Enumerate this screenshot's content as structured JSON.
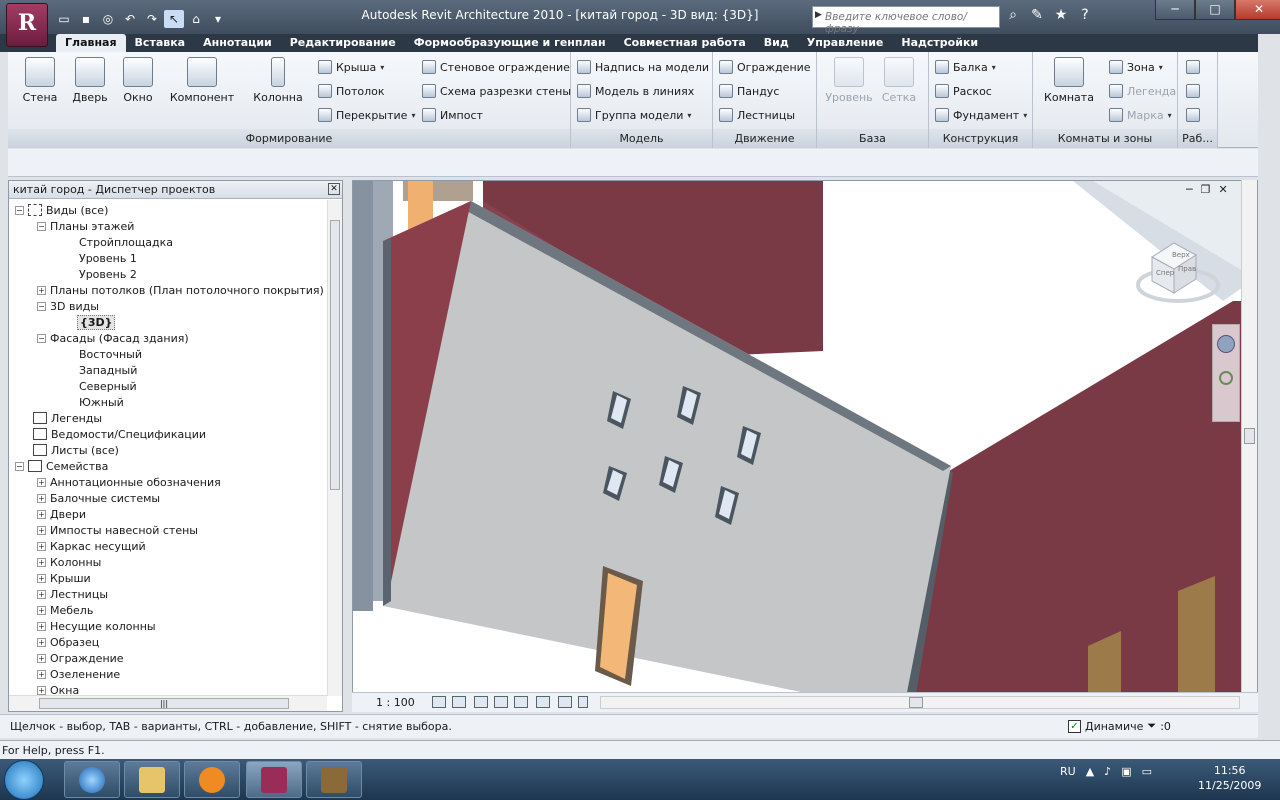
{
  "app": {
    "logo_letter": "R",
    "title": "Autodesk Revit Architecture 2010 - [китай город - 3D вид: {3D}]",
    "search_placeholder": "Введите ключевое слово/фразу",
    "controls": {
      "minimize": "─",
      "maximize": "□",
      "close": "✕"
    }
  },
  "tabs": [
    "Главная",
    "Вставка",
    "Аннотации",
    "Редактирование",
    "Формообразующие и генплан",
    "Совместная работа",
    "Вид",
    "Управление",
    "Надстройки"
  ],
  "ribbon": {
    "forming": {
      "title": "Формирование",
      "big": [
        "Стена",
        "Дверь",
        "Окно",
        "Компонент",
        "Колонна"
      ],
      "small": [
        "Крыша",
        "Потолок",
        "Перекрытие",
        "Стеновое ограждение",
        "Схема разрезки стены",
        "Импост"
      ]
    },
    "model": {
      "title": "Модель",
      "small": [
        "Надпись на модели",
        "Модель в линиях",
        "Группа модели"
      ]
    },
    "movement": {
      "title": "Движение",
      "small": [
        "Ограждение",
        "Пандус",
        "Лестницы"
      ]
    },
    "base": {
      "title": "База",
      "big": [
        "Уровень",
        "Сетка"
      ]
    },
    "construction": {
      "title": "Конструкция",
      "small": [
        "Балка",
        "Раскос",
        "Фундамент"
      ]
    },
    "rooms": {
      "title": "Комнаты и зоны",
      "big": [
        "Комната"
      ],
      "small": [
        "Зона",
        "Легенда",
        "Марка"
      ]
    },
    "work": {
      "title": "Раб..."
    }
  },
  "browser": {
    "title": "китай город - Диспетчер проектов",
    "items": [
      {
        "label": "Виды (все)"
      },
      {
        "label": "Планы этажей"
      },
      {
        "label": "Стройплощадка"
      },
      {
        "label": "Уровень 1"
      },
      {
        "label": "Уровень 2"
      },
      {
        "label": "Планы потолков (План потолочного покрытия)"
      },
      {
        "label": "3D виды"
      },
      {
        "label": "{3D}"
      },
      {
        "label": "Фасады (Фасад здания)"
      },
      {
        "label": "Восточный"
      },
      {
        "label": "Западный"
      },
      {
        "label": "Северный"
      },
      {
        "label": "Южный"
      },
      {
        "label": "Легенды"
      },
      {
        "label": "Ведомости/Спецификации"
      },
      {
        "label": "Листы (все)"
      },
      {
        "label": "Семейства"
      },
      {
        "label": "Аннотационные обозначения"
      },
      {
        "label": "Балочные системы"
      },
      {
        "label": "Двери"
      },
      {
        "label": "Импосты навесной стены"
      },
      {
        "label": "Каркас несущий"
      },
      {
        "label": "Колонны"
      },
      {
        "label": "Крыши"
      },
      {
        "label": "Лестницы"
      },
      {
        "label": "Мебель"
      },
      {
        "label": "Несущие колонны"
      },
      {
        "label": "Образец"
      },
      {
        "label": "Ограждение"
      },
      {
        "label": "Озеленение"
      },
      {
        "label": "Окна"
      }
    ]
  },
  "viewport": {
    "scale": "1 : 100",
    "viewcube": {
      "top": "Верх",
      "front": "Спер",
      "right": "Прав"
    }
  },
  "status": {
    "hint": "Щелчок - выбор, TAB - варианты, CTRL - добавление, SHIFT - снятие выбора.",
    "dynamic_label": "Динамиче",
    "filter_count": ":0",
    "help": "For Help, press F1."
  },
  "taskbar": {
    "lang": "RU",
    "time": "11:56",
    "date": "11/25/2009"
  }
}
